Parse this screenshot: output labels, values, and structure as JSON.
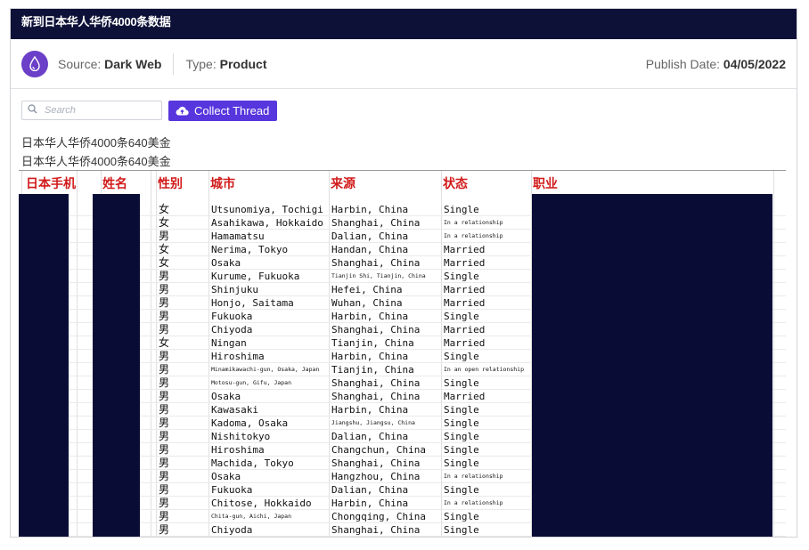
{
  "header": {
    "title": "新到日本华人华侨4000条数据"
  },
  "meta": {
    "source_label": "Source:",
    "source_value": "Dark Web",
    "type_label": "Type:",
    "type_value": "Product",
    "publish_label": "Publish Date:",
    "publish_value": "04/05/2022"
  },
  "toolbar": {
    "search_placeholder": "Search",
    "collect_label": "Collect Thread"
  },
  "post": {
    "line1": "日本华人华侨4000条640美金",
    "line2": "日本华人华侨4000条640美金"
  },
  "colors": {
    "header_bg": "#0d1137",
    "accent": "#5736dd",
    "source_logo": "#6b3fc7",
    "redaction": "#090d36",
    "column_header": "#d11a1a"
  },
  "icons": {
    "source": "drop-icon",
    "search": "search-icon",
    "collect": "cloud-upload-icon"
  },
  "table": {
    "columns": [
      "日本手机",
      "姓名",
      "性别",
      "城市",
      "来源",
      "状态",
      "职业"
    ],
    "rows": [
      {
        "gender": "女",
        "city": "Utsunomiya, Tochigi",
        "origin": "Harbin, China",
        "status": "Single"
      },
      {
        "gender": "女",
        "city": "Asahikawa, Hokkaido",
        "origin": "Shanghai, China",
        "status": "In a relationship"
      },
      {
        "gender": "男",
        "city": "Hamamatsu",
        "origin": "Dalian, China",
        "status": "In a relationship"
      },
      {
        "gender": "女",
        "city": "Nerima, Tokyo",
        "origin": "Handan, China",
        "status": "Married"
      },
      {
        "gender": "女",
        "city": "Osaka",
        "origin": "Shanghai, China",
        "status": "Married"
      },
      {
        "gender": "男",
        "city": "Kurume, Fukuoka",
        "origin": "Tianjin Shi, Tianjin, China",
        "status": "Single"
      },
      {
        "gender": "男",
        "city": "Shinjuku",
        "origin": "Hefei, China",
        "status": "Married"
      },
      {
        "gender": "男",
        "city": "Honjo, Saitama",
        "origin": "Wuhan, China",
        "status": "Married"
      },
      {
        "gender": "男",
        "city": "Fukuoka",
        "origin": "Harbin, China",
        "status": "Single"
      },
      {
        "gender": "男",
        "city": "Chiyoda",
        "origin": "Shanghai, China",
        "status": "Married"
      },
      {
        "gender": "女",
        "city": "Ningan",
        "origin": "Tianjin, China",
        "status": "Married"
      },
      {
        "gender": "男",
        "city": "Hiroshima",
        "origin": "Harbin, China",
        "status": "Single"
      },
      {
        "gender": "男",
        "city": "Minamikawachi-gun, Osaka, Japan",
        "origin": "Tianjin, China",
        "status": "In an open relationship"
      },
      {
        "gender": "男",
        "city": "Motosu-gun, Gifu, Japan",
        "origin": "Shanghai, China",
        "status": "Single"
      },
      {
        "gender": "男",
        "city": "Osaka",
        "origin": "Shanghai, China",
        "status": "Married"
      },
      {
        "gender": "男",
        "city": "Kawasaki",
        "origin": "Harbin, China",
        "status": "Single"
      },
      {
        "gender": "男",
        "city": "Kadoma, Osaka",
        "origin": "Jiangshu, Jiangsu, China",
        "status": "Single"
      },
      {
        "gender": "男",
        "city": "Nishitokyo",
        "origin": "Dalian, China",
        "status": "Single"
      },
      {
        "gender": "男",
        "city": "Hiroshima",
        "origin": "Changchun, China",
        "status": "Single"
      },
      {
        "gender": "男",
        "city": "Machida, Tokyo",
        "origin": "Shanghai, China",
        "status": "Single"
      },
      {
        "gender": "男",
        "city": "Osaka",
        "origin": "Hangzhou, China",
        "status": "In a relationship"
      },
      {
        "gender": "男",
        "city": "Fukuoka",
        "origin": "Dalian, China",
        "status": "Single"
      },
      {
        "gender": "男",
        "city": "Chitose, Hokkaido",
        "origin": "Harbin, China",
        "status": "In a relationship"
      },
      {
        "gender": "男",
        "city": "Chita-gun, Aichi, Japan",
        "origin": "Chongqing, China",
        "status": "Single"
      },
      {
        "gender": "男",
        "city": "Chiyoda",
        "origin": "Shanghai, China",
        "status": "Single"
      },
      {
        "gender": "男",
        "city": "",
        "origin": "",
        "status": ""
      }
    ]
  }
}
